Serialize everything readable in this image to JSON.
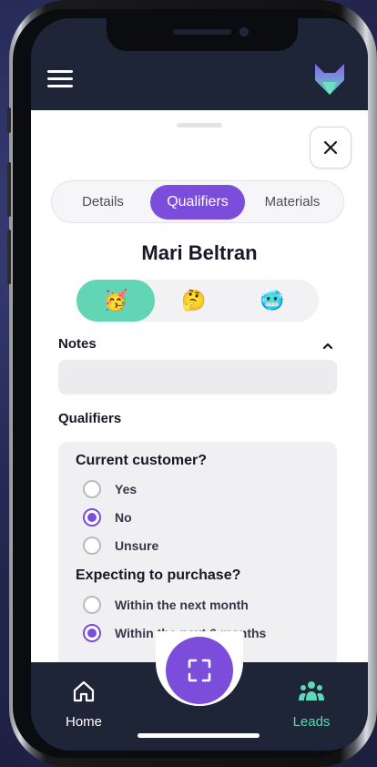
{
  "header": {
    "menu_icon": "hamburger-menu-icon",
    "logo_icon": "fox-logo-icon"
  },
  "sheet": {
    "close_icon": "close-icon",
    "tabs": [
      {
        "label": "Details",
        "active": false
      },
      {
        "label": "Qualifiers",
        "active": true
      },
      {
        "label": "Materials",
        "active": false
      }
    ],
    "lead_name": "Mari Beltran",
    "mood_options": [
      {
        "emoji": "🥳",
        "name": "party-face",
        "selected": true
      },
      {
        "emoji": "🤔",
        "name": "thinking-face",
        "selected": false
      },
      {
        "emoji": "🥶",
        "name": "cold-face",
        "selected": false
      }
    ],
    "notes_title": "Notes",
    "notes_value": "",
    "qualifiers_title": "Qualifiers",
    "questions": [
      {
        "title": "Current customer?",
        "options": [
          {
            "label": "Yes",
            "checked": false
          },
          {
            "label": "No",
            "checked": true
          },
          {
            "label": "Unsure",
            "checked": false
          }
        ]
      },
      {
        "title": "Expecting to purchase?",
        "options": [
          {
            "label": "Within the next month",
            "checked": false
          },
          {
            "label": "Within the next 6 months",
            "checked": true
          }
        ]
      }
    ]
  },
  "bottom_nav": {
    "home_label": "Home",
    "leads_label": "Leads",
    "scan_icon": "scan-icon"
  },
  "colors": {
    "accent": "#7c4ddb",
    "mint": "#62d5b5",
    "dark": "#1e2537"
  }
}
